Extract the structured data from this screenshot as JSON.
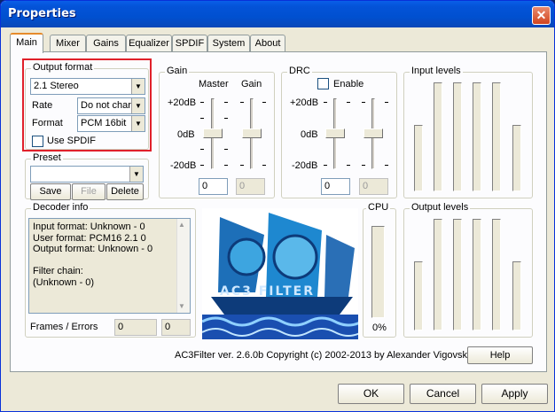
{
  "window": {
    "title": "Properties"
  },
  "tabs": [
    "Main",
    "Mixer",
    "Gains",
    "Equalizer",
    "SPDIF",
    "System",
    "About"
  ],
  "output_format": {
    "label": "Output format",
    "format_value": "2.1 Stereo",
    "rate_label": "Rate",
    "rate_value": "Do not char",
    "format_label": "Format",
    "sample_value": "PCM 16bit",
    "use_spdif": "Use SPDIF",
    "use_spdif_checked": false
  },
  "preset": {
    "label": "Preset",
    "value": "",
    "save": "Save",
    "file": "File",
    "delete": "Delete"
  },
  "gain": {
    "label": "Gain",
    "master": "Master",
    "gain": "Gain",
    "plus": "+20dB",
    "zero": "0dB",
    "minus": "-20dB",
    "master_value": "0",
    "gain_value": "0"
  },
  "drc": {
    "label": "DRC",
    "enable": "Enable",
    "enable_checked": false,
    "plus": "+20dB",
    "zero": "0dB",
    "minus": "-20dB",
    "value1": "0",
    "value2": "0"
  },
  "input_levels": {
    "label": "Input levels"
  },
  "output_levels": {
    "label": "Output levels"
  },
  "decoder": {
    "label": "Decoder info",
    "lines": [
      "Input format: Unknown - 0",
      "User format: PCM16 2.1 0",
      "Output format: Unknown - 0",
      "",
      "Filter chain:",
      "(Unknown - 0)"
    ],
    "frames_label": "Frames / Errors",
    "frames": "0",
    "errors": "0"
  },
  "cpu": {
    "label": "CPU",
    "value": "0%"
  },
  "logo": {
    "text": "AC3 FILTER"
  },
  "footer": {
    "copyright": "AC3Filter ver. 2.6.0b Copyright (c) 2002-2013 by Alexander Vigovsky",
    "help": "Help"
  },
  "buttons": {
    "ok": "OK",
    "cancel": "Cancel",
    "apply": "Apply"
  }
}
